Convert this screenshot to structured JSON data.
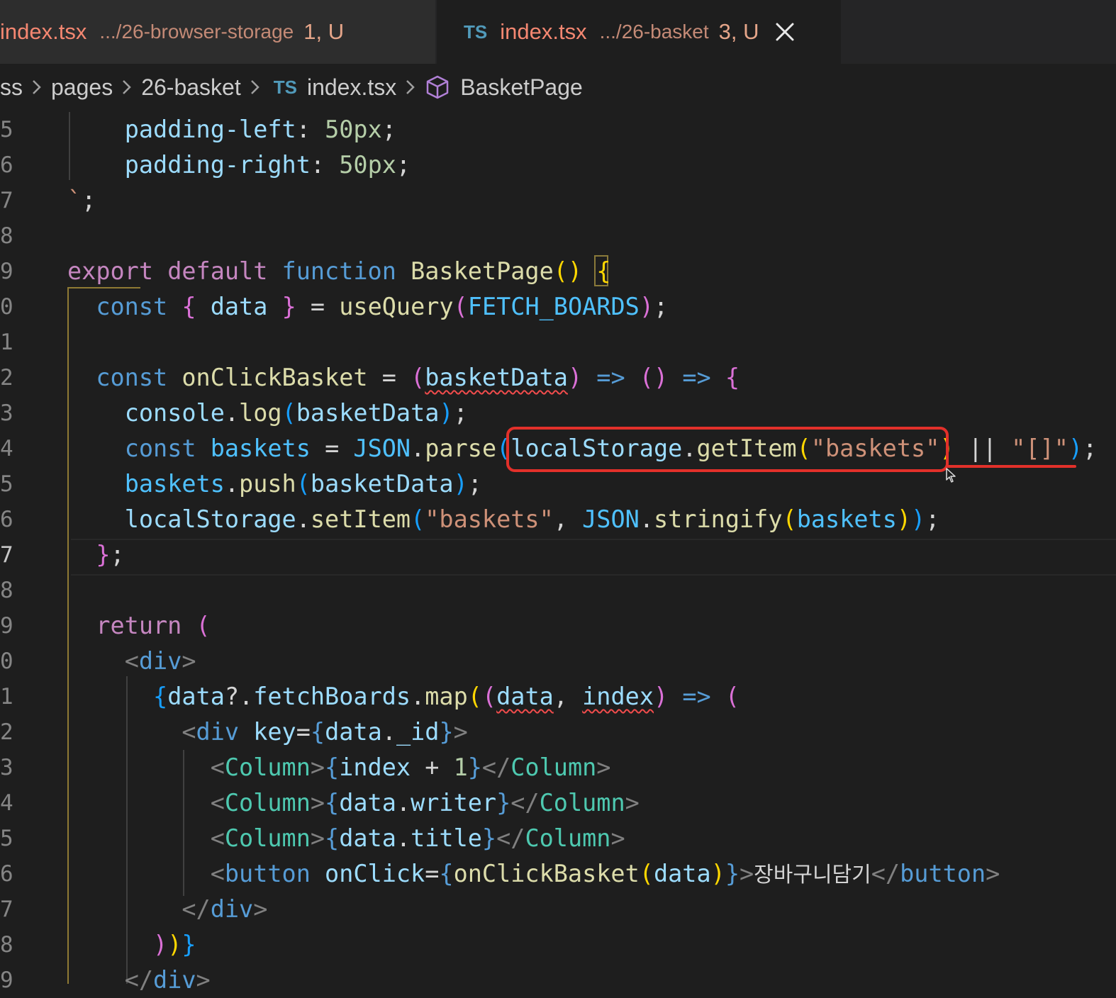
{
  "tabs": [
    {
      "icon": "",
      "name": "index.tsx",
      "path": ".../26-browser-storage",
      "status": "1, U",
      "active": false
    },
    {
      "icon": "TS",
      "name": "index.tsx",
      "path": ".../26-basket",
      "status": "3, U",
      "active": true
    }
  ],
  "breadcrumb": {
    "items": [
      "ss",
      "pages",
      "26-basket"
    ],
    "file_icon": "TS",
    "file": "index.tsx",
    "symbol": "BasketPage"
  },
  "line_numbers": [
    "5",
    "6",
    "7",
    "8",
    "9",
    "0",
    "1",
    "2",
    "3",
    "4",
    "5",
    "6",
    "7",
    "8",
    "9",
    "0",
    "1",
    "2",
    "3",
    "4",
    "5",
    "6",
    "7",
    "8",
    "9"
  ],
  "code": {
    "l5": {
      "prop": "padding-left",
      "colon": ": ",
      "val": "50px",
      "semi": ";"
    },
    "l6": {
      "prop": "padding-right",
      "colon": ": ",
      "val": "50px",
      "semi": ";"
    },
    "l7": {
      "tick": "`",
      "semi": ";"
    },
    "l9": {
      "export": "export",
      "default": "default",
      "function": "function",
      "name": "BasketPage",
      "parens": "()",
      "brace": "{"
    },
    "l10": {
      "const": "const",
      "lb": "{",
      "data": "data",
      "rb": "}",
      "eq": "=",
      "fn": "useQuery",
      "lp": "(",
      "arg": "FETCH_BOARDS",
      "rp": ")",
      "semi": ";"
    },
    "l12": {
      "const": "const",
      "name": "onClickBasket",
      "eq": "=",
      "lp": "(",
      "param": "basketData",
      "rp": ")",
      "arrow1": "=>",
      "empty": "()",
      "arrow2": "=>",
      "brace": "{"
    },
    "l13": {
      "obj": "console",
      "dot": ".",
      "fn": "log",
      "lp": "(",
      "arg": "basketData",
      "rp": ")",
      "semi": ";"
    },
    "l14": {
      "const": "const",
      "name": "baskets",
      "eq": "=",
      "json": "JSON",
      "dot": ".",
      "fn": "parse",
      "lp": "(",
      "obj": "localStorage",
      "dot2": ".",
      "fn2": "getItem",
      "lp2": "(",
      "str": "\"baskets\"",
      "rp2": ")",
      "or": "||",
      "str2": "\"[]\"",
      "rp": ")",
      "semi": ";"
    },
    "l15": {
      "obj": "baskets",
      "dot": ".",
      "fn": "push",
      "lp": "(",
      "arg": "basketData",
      "rp": ")",
      "semi": ";"
    },
    "l16": {
      "obj": "localStorage",
      "dot": ".",
      "fn": "setItem",
      "lp": "(",
      "str": "\"baskets\"",
      "comma": ", ",
      "json": "JSON",
      "dot2": ".",
      "fn2": "stringify",
      "lp2": "(",
      "arg": "baskets",
      "rp2": ")",
      "rp": ")",
      "semi": ";"
    },
    "l17": {
      "brace": "}",
      "semi": ";"
    },
    "l19": {
      "ret": "return",
      "lp": "("
    },
    "l20": {
      "lt": "<",
      "tag": "div",
      "gt": ">"
    },
    "l21": {
      "lb": "{",
      "obj": "data",
      "opt": "?.",
      "prop": "fetchBoards",
      "dot": ".",
      "fn": "map",
      "lp": "(",
      "lp2": "(",
      "a1": "data",
      "comma": ", ",
      "a2": "index",
      "rp2": ")",
      "arrow": "=>",
      "lp3": "("
    },
    "l22": {
      "lt": "<",
      "tag": "div",
      "attr": "key",
      "eq": "=",
      "lb": "{",
      "obj": "data",
      "dot": ".",
      "prop": "_id",
      "rb": "}",
      "gt": ">"
    },
    "l23": {
      "lt": "<",
      "tag": "Column",
      "gt": ">",
      "lb": "{",
      "expr": "index",
      "plus": " + ",
      "num": "1",
      "rb": "}",
      "clt": "</",
      "ctag": "Column",
      "cgt": ">"
    },
    "l24": {
      "lt": "<",
      "tag": "Column",
      "gt": ">",
      "lb": "{",
      "obj": "data",
      "dot": ".",
      "prop": "writer",
      "rb": "}",
      "clt": "</",
      "ctag": "Column",
      "cgt": ">"
    },
    "l25": {
      "lt": "<",
      "tag": "Column",
      "gt": ">",
      "lb": "{",
      "obj": "data",
      "dot": ".",
      "prop": "title",
      "rb": "}",
      "clt": "</",
      "ctag": "Column",
      "cgt": ">"
    },
    "l26": {
      "lt": "<",
      "tag": "button",
      "attr": "onClick",
      "eq": "=",
      "lb": "{",
      "fn": "onClickBasket",
      "lp": "(",
      "arg": "data",
      "rp": ")",
      "rb": "}",
      "gt": ">",
      "text": "장바구니담기",
      "clt": "</",
      "ctag": "button",
      "cgt": ">"
    },
    "l27": {
      "clt": "</",
      "ctag": "div",
      "cgt": ">"
    },
    "l28": {
      "rp": ")",
      "rp2": ")",
      "rb": "}"
    },
    "l29": {
      "clt": "</",
      "ctag": "div",
      "cgt": ">"
    }
  },
  "colors": {
    "annotation": "#e2302a",
    "background": "#1e1e1e",
    "tab_modified": "#f48771"
  }
}
